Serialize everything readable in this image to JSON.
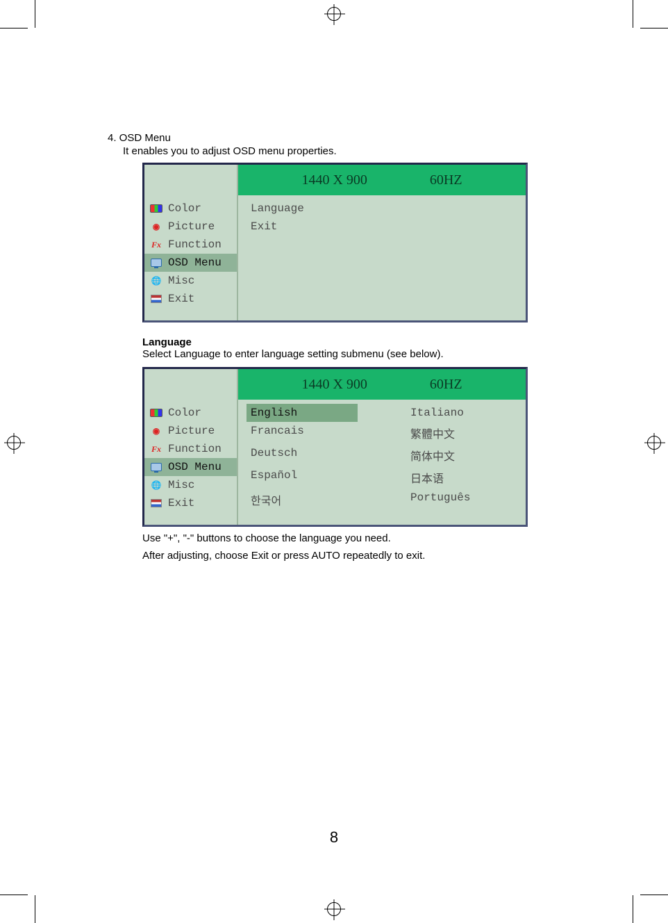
{
  "doc": {
    "section_title": "4. OSD Menu",
    "section_desc": "It enables you to adjust OSD menu properties.",
    "lang_heading": "Language",
    "lang_desc": "Select Language to enter language setting submenu (see below).",
    "caption1": "Use \"+\", \"-\" buttons to choose the language you need.",
    "caption2": "After adjusting, choose Exit or press AUTO repeatedly to exit.",
    "page_number": "8"
  },
  "osd": {
    "resolution": "1440 X 900",
    "refresh": "60HZ",
    "sidebar": {
      "color": "Color",
      "picture": "Picture",
      "function": "Function",
      "osdmenu": "OSD Menu",
      "misc": "Misc",
      "exit": "Exit"
    },
    "panel1": {
      "language": "Language",
      "exit": "Exit"
    },
    "languages": {
      "english": "English",
      "francais": "Francais",
      "deutsch": "Deutsch",
      "espanol": "Español",
      "korean": "한국어",
      "italiano": "Italiano",
      "trad_chinese": "繁體中文",
      "simp_chinese": "简体中文",
      "japanese": "日本语",
      "portuguese": "Português"
    }
  }
}
